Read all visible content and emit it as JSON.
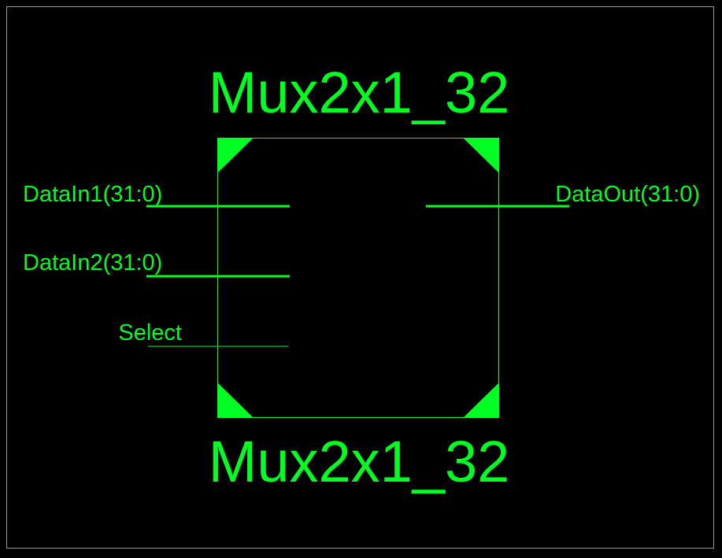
{
  "symbol": {
    "name_top": "Mux2x1_32",
    "name_bottom": "Mux2x1_32",
    "color": "#00ff22",
    "background": "#000000",
    "frame_color": "#9a9a9a"
  },
  "pins": {
    "datain1": {
      "label": "DataIn1(31:0)",
      "type": "bus",
      "side": "left"
    },
    "datain2": {
      "label": "DataIn2(31:0)",
      "type": "bus",
      "side": "left"
    },
    "select": {
      "label": "Select",
      "type": "wire",
      "side": "left"
    },
    "dataout": {
      "label": "DataOut(31:0)",
      "type": "bus",
      "side": "right"
    }
  }
}
